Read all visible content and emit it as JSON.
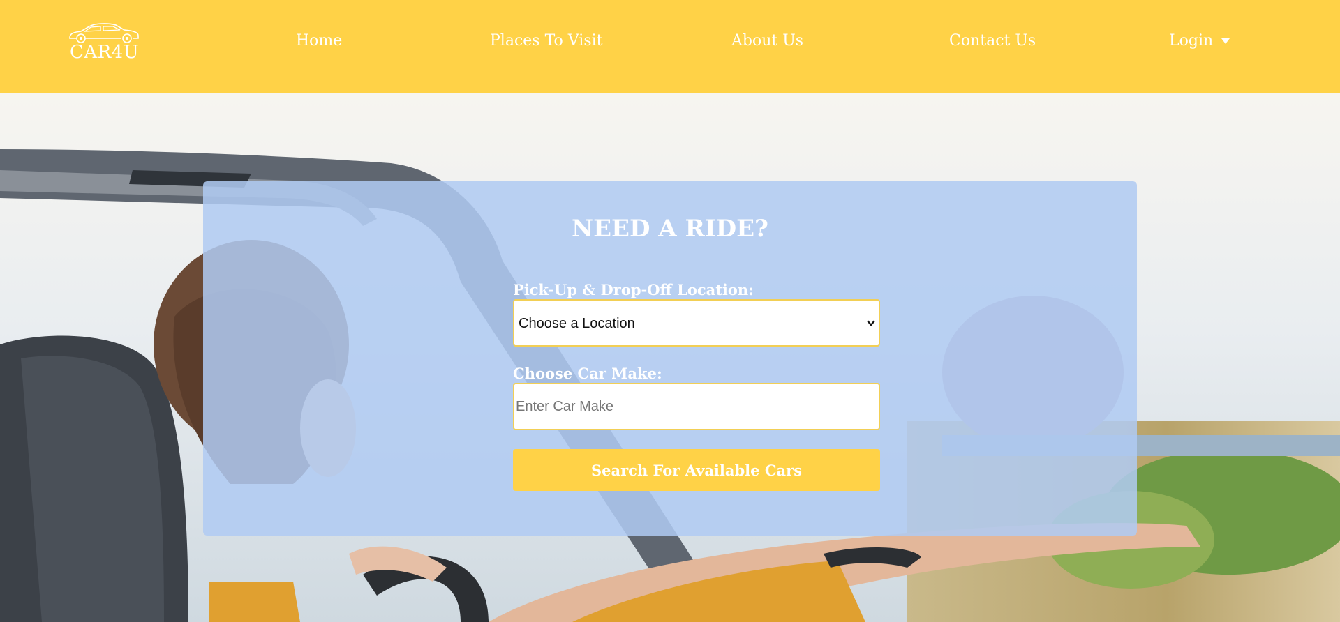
{
  "brand": {
    "logo_text": "CAR4U"
  },
  "nav": {
    "home": "Home",
    "places": "Places To Visit",
    "about": "About Us",
    "contact": "Contact Us",
    "login": "Login"
  },
  "booking": {
    "title": "NEED A RIDE?",
    "location_label": "Pick-Up & Drop-Off Location:",
    "location_selected": "Choose a Location",
    "make_label": "Choose Car Make:",
    "make_placeholder": "Enter Car Make",
    "search_button": "Search For Available Cars"
  },
  "icons": {
    "logo": "car-outline-icon",
    "login_caret": "caret-down-icon",
    "select_chevron": "chevron-down-icon"
  },
  "colors": {
    "header": "#ffd247",
    "panel": "#b0cbf2",
    "button": "#ffd247",
    "text": "#ffffff"
  }
}
